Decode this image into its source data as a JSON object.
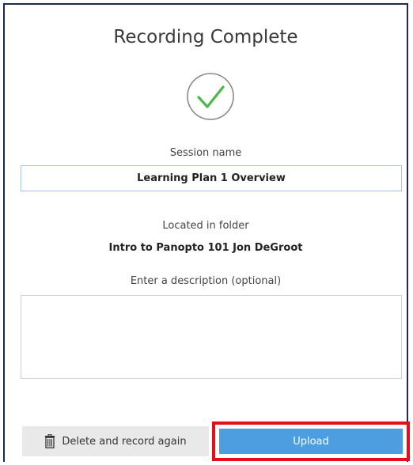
{
  "dialog": {
    "title": "Recording Complete",
    "status_icon": "checkmark-circle-icon"
  },
  "session": {
    "label": "Session name",
    "value": "Learning Plan 1 Overview"
  },
  "folder": {
    "label": "Located in folder",
    "value": "Intro to Panopto 101 Jon DeGroot"
  },
  "description": {
    "label": "Enter a description (optional)",
    "value": ""
  },
  "actions": {
    "delete_label": "Delete and record again",
    "delete_icon": "trash-icon",
    "upload_label": "Upload"
  },
  "colors": {
    "check": "#4cb84c",
    "upload": "#4c9ee0",
    "highlight": "#e30e1a",
    "frame": "#1c2a4a"
  }
}
